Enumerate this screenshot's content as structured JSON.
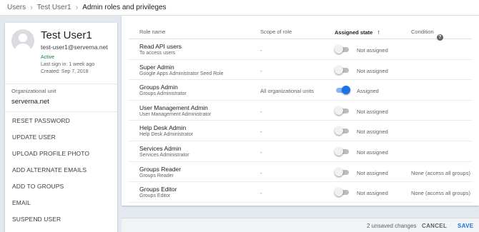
{
  "breadcrumb": [
    "Users",
    "Test User1",
    "Admin roles and privileges"
  ],
  "user": {
    "name": "Test User1",
    "email": "test-user1@serverna.net",
    "status": "Active",
    "last_sign_in": "Last sign in: 1 week ago",
    "created": "Created: Sep 7, 2018",
    "org_label": "Organizational unit",
    "org_value": "serverna.net"
  },
  "actions": [
    "RESET PASSWORD",
    "UPDATE USER",
    "UPLOAD PROFILE PHOTO",
    "ADD ALTERNATE EMAILS",
    "ADD TO GROUPS",
    "EMAIL",
    "SUSPEND USER"
  ],
  "table": {
    "headers": {
      "role": "Role name",
      "scope": "Scope of role",
      "state": "Assigned state",
      "condition": "Condition"
    },
    "rows": [
      {
        "name": "Read API users",
        "desc": "To access users",
        "scope": "-",
        "assigned": false,
        "state": "Not assigned",
        "condition": ""
      },
      {
        "name": "Super Admin",
        "desc": "Google Apps Administrator Seed Role",
        "scope": "-",
        "assigned": false,
        "state": "Not assigned",
        "condition": ""
      },
      {
        "name": "Groups Admin",
        "desc": "Groups Administrator",
        "scope": "All organizational units",
        "assigned": true,
        "state": "Assigned",
        "condition": ""
      },
      {
        "name": "User Management Admin",
        "desc": "User Management Administrator",
        "scope": "-",
        "assigned": false,
        "state": "Not assigned",
        "condition": ""
      },
      {
        "name": "Help Desk Admin",
        "desc": "Help Desk Administrator",
        "scope": "-",
        "assigned": false,
        "state": "Not assigned",
        "condition": ""
      },
      {
        "name": "Services Admin",
        "desc": "Services Administrator",
        "scope": "-",
        "assigned": false,
        "state": "Not assigned",
        "condition": ""
      },
      {
        "name": "Groups Reader",
        "desc": "Groups Reader",
        "scope": "-",
        "assigned": false,
        "state": "Not assigned",
        "condition": "None (access all groups)"
      },
      {
        "name": "Groups Editor",
        "desc": "Groups Editor",
        "scope": "-",
        "assigned": false,
        "state": "Not assigned",
        "condition": "None (access all groups)"
      }
    ]
  },
  "footer": {
    "unsaved": "2 unsaved changes",
    "cancel": "CANCEL",
    "save": "SAVE"
  },
  "colors": {
    "accent": "#1a73e8",
    "active": "#188038",
    "page_bg": "#e4e8ef"
  },
  "icons": {
    "sort": "arrow-up-icon",
    "help": "help-circle-icon",
    "breadcrumb_sep": "chevron-right-icon"
  }
}
